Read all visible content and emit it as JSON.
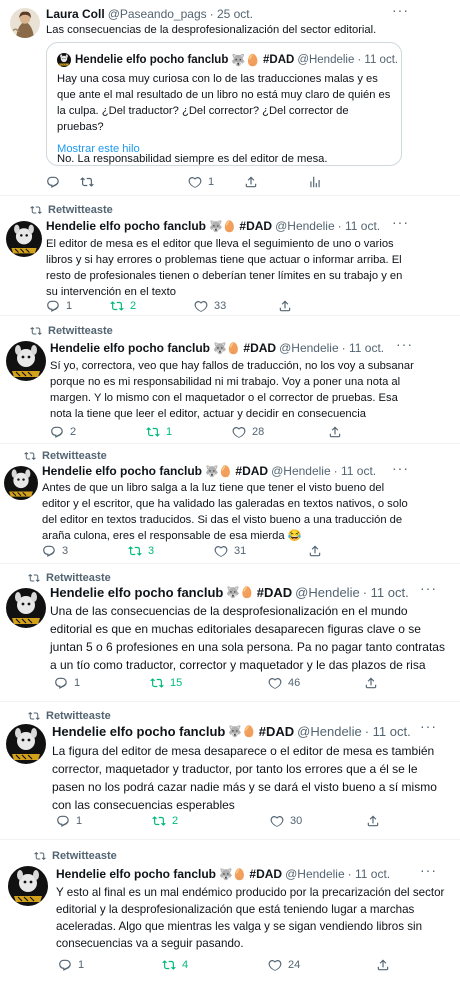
{
  "icons": {
    "retweet": "retweet-icon",
    "reply": "reply-icon",
    "like": "heart-icon",
    "share": "share-icon",
    "views": "views-icon",
    "more": "more-icon"
  },
  "colors": {
    "muted": "#536471",
    "green": "#00ba7c",
    "link": "#1d9bf0",
    "border": "#cfd9de"
  },
  "top_tweet": {
    "name": "Laura Coll",
    "handle": "@Paseando_pags",
    "date": "· 25 oct.",
    "text": "Las consecuencias de la desprofesionalización del sector editorial.",
    "more": "···",
    "quote": {
      "name": "Hendelie elfo pocho fanclub",
      "emojis": "🐺🥚",
      "tag": "#DAD",
      "handle": "@Hendelie",
      "date": "· 11 oct.",
      "text": "Hay una cosa muy curiosa con lo de las traducciones malas y es que ante el mal resultado de un libro no está muy claro de quién es la culpa. ¿Del traductor? ¿Del corrector? ¿Del corrector de pruebas?\n\nNo. La responsabilidad siempre es del editor de mesa.",
      "show_thread": "Mostrar este hilo"
    },
    "replies": "",
    "retweets": "",
    "likes": "1"
  },
  "retweet_label": "Retwitteaste",
  "thread": [
    {
      "name": "Hendelie elfo pocho fanclub",
      "emojis": "🐺🥚",
      "tag": "#DAD",
      "handle": "@Hendelie",
      "date": "· 11 oct.",
      "text": "El editor de mesa es el editor que lleva el seguimiento de uno o varios libros y si hay errores o problemas tiene que actuar o informar arriba. El resto de profesionales tienen o deberían tener límites en su trabajo y en su intervención en el texto",
      "replies": "1",
      "retweets": "2",
      "likes": "33"
    },
    {
      "name": "Hendelie elfo pocho fanclub",
      "emojis": "🐺🥚",
      "tag": "#DAD",
      "handle": "@Hendelie",
      "date": "· 11 oct.",
      "text": "Sí yo, correctora, veo que hay fallos de traducción, no los voy a subsanar porque no es mi responsabilidad ni mi trabajo. Voy a poner una nota al margen. Y lo mismo con el maquetador o el corrector de pruebas. Esa nota la tiene que leer el editor, actuar y decidir en consecuencia",
      "replies": "2",
      "retweets": "1",
      "likes": "28"
    },
    {
      "name": "Hendelie elfo pocho fanclub",
      "emojis": "🐺🥚",
      "tag": "#DAD",
      "handle": "@Hendelie",
      "date": "· 11 oct.",
      "text": "Antes de que un libro salga a la luz tiene que tener el visto bueno del editor y el escritor, que ha validado las galeradas en textos nativos, o solo del editor en textos traducidos. Si das el visto bueno a una traducción de araña culona, eres el responsable de esa mierda 😂",
      "replies": "3",
      "retweets": "3",
      "likes": "31"
    },
    {
      "name": "Hendelie elfo pocho fanclub",
      "emojis": "🐺🥚",
      "tag": "#DAD",
      "handle": "@Hendelie",
      "date": "· 11 oct.",
      "text": "Una de las consecuencias de la desprofesionalización en el mundo editorial es que en muchas editoriales desaparecen figuras clave o se juntan 5 o 6 profesiones en una sola persona. Pa no pagar tanto contratas a un tío como traductor, corrector y maquetador y le das plazos de risa",
      "replies": "1",
      "retweets": "15",
      "likes": "46"
    },
    {
      "name": "Hendelie elfo pocho fanclub",
      "emojis": "🐺🥚",
      "tag": "#DAD",
      "handle": "@Hendelie",
      "date": "· 11 oct.",
      "text": "La figura del editor de mesa desaparece o el editor de mesa es también corrector, maquetador y traductor, por tanto los errores que a él se le pasen no los podrá cazar nadie más y se dará el visto bueno a sí mismo con las consecuencias esperables",
      "replies": "1",
      "retweets": "2",
      "likes": "30"
    },
    {
      "name": "Hendelie elfo pocho fanclub",
      "emojis": "🐺🥚",
      "tag": "#DAD",
      "handle": "@Hendelie",
      "date": "· 11 oct.",
      "text": "Y esto al final es un mal endémico producido por la precarización del sector editorial y la desprofesionalización que está teniendo lugar a marchas aceleradas. Algo que mientras les valga y se sigan vendiendo libros sin consecuencias va a seguir pasando.",
      "replies": "1",
      "retweets": "4",
      "likes": "24"
    }
  ]
}
